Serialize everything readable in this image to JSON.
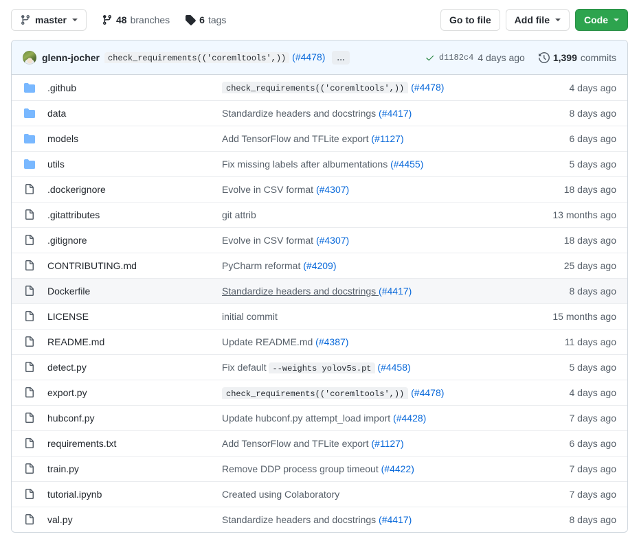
{
  "toolbar": {
    "branch": {
      "name": "master",
      "icon": "git-branch-icon",
      "caret": "chevron-down-icon"
    },
    "branches": {
      "count": "48",
      "label": "branches",
      "icon": "git-branch-icon"
    },
    "tags": {
      "count": "6",
      "label": "tags",
      "icon": "tag-icon"
    },
    "go_to_file": "Go to file",
    "add_file": "Add file",
    "code": "Code"
  },
  "commit_header": {
    "avatar": "user-avatar",
    "author": "glenn-jocher",
    "message_code": "check_requirements(('coremltools',))",
    "message_pr": "(#4478)",
    "ellipsis": "...",
    "status_icon": "check-icon",
    "status_check": "✓",
    "sha": "d1182c4",
    "time": "4 days ago",
    "history_icon": "history-icon",
    "commits_count": "1,399",
    "commits_label": "commits"
  },
  "colors": {
    "accent": "#0969da",
    "green_button": "#2da44e",
    "check_green": "#1a7f37",
    "folder_blue": "#79b8ff",
    "file_gray": "#57606a",
    "header_tint": "#f1f8ff",
    "row_hover": "#f6f7f9",
    "border": "#d0d7de",
    "muted_text": "#57606a"
  },
  "files": [
    {
      "type": "folder",
      "icon": "folder-icon",
      "name": ".github",
      "message": "",
      "code": "check_requirements(('coremltools',))",
      "pr": "(#4478)",
      "time": "4 days ago",
      "hovered": false
    },
    {
      "type": "folder",
      "icon": "folder-icon",
      "name": "data",
      "message": "Standardize headers and docstrings ",
      "code": "",
      "pr": "(#4417)",
      "time": "8 days ago",
      "hovered": false
    },
    {
      "type": "folder",
      "icon": "folder-icon",
      "name": "models",
      "message": "Add TensorFlow and TFLite export ",
      "code": "",
      "pr": "(#1127)",
      "time": "6 days ago",
      "hovered": false
    },
    {
      "type": "folder",
      "icon": "folder-icon",
      "name": "utils",
      "message": "Fix missing labels after albumentations ",
      "code": "",
      "pr": "(#4455)",
      "time": "5 days ago",
      "hovered": false
    },
    {
      "type": "file",
      "icon": "file-icon",
      "name": ".dockerignore",
      "message": "Evolve in CSV format ",
      "code": "",
      "pr": "(#4307)",
      "time": "18 days ago",
      "hovered": false
    },
    {
      "type": "file",
      "icon": "file-icon",
      "name": ".gitattributes",
      "message": "git attrib",
      "code": "",
      "pr": "",
      "time": "13 months ago",
      "hovered": false
    },
    {
      "type": "file",
      "icon": "file-icon",
      "name": ".gitignore",
      "message": "Evolve in CSV format ",
      "code": "",
      "pr": "(#4307)",
      "time": "18 days ago",
      "hovered": false
    },
    {
      "type": "file",
      "icon": "file-icon",
      "name": "CONTRIBUTING.md",
      "message": "PyCharm reformat ",
      "code": "",
      "pr": "(#4209)",
      "time": "25 days ago",
      "hovered": false
    },
    {
      "type": "file",
      "icon": "file-icon",
      "name": "Dockerfile",
      "message": "Standardize headers and docstrings ",
      "code": "",
      "pr": "(#4417)",
      "time": "8 days ago",
      "hovered": true
    },
    {
      "type": "file",
      "icon": "file-icon",
      "name": "LICENSE",
      "message": "initial commit",
      "code": "",
      "pr": "",
      "time": "15 months ago",
      "hovered": false
    },
    {
      "type": "file",
      "icon": "file-icon",
      "name": "README.md",
      "message": "Update README.md ",
      "code": "",
      "pr": "(#4387)",
      "time": "11 days ago",
      "hovered": false
    },
    {
      "type": "file",
      "icon": "file-icon",
      "name": "detect.py",
      "message": "Fix default ",
      "code": "--weights yolov5s.pt",
      "pr": "(#4458)",
      "time": "5 days ago",
      "hovered": false
    },
    {
      "type": "file",
      "icon": "file-icon",
      "name": "export.py",
      "message": "",
      "code": "check_requirements(('coremltools',))",
      "pr": "(#4478)",
      "time": "4 days ago",
      "hovered": false
    },
    {
      "type": "file",
      "icon": "file-icon",
      "name": "hubconf.py",
      "message": "Update hubconf.py attempt_load import ",
      "code": "",
      "pr": "(#4428)",
      "time": "7 days ago",
      "hovered": false
    },
    {
      "type": "file",
      "icon": "file-icon",
      "name": "requirements.txt",
      "message": "Add TensorFlow and TFLite export ",
      "code": "",
      "pr": "(#1127)",
      "time": "6 days ago",
      "hovered": false
    },
    {
      "type": "file",
      "icon": "file-icon",
      "name": "train.py",
      "message": "Remove DDP process group timeout ",
      "code": "",
      "pr": "(#4422)",
      "time": "7 days ago",
      "hovered": false
    },
    {
      "type": "file",
      "icon": "file-icon",
      "name": "tutorial.ipynb",
      "message": "Created using Colaboratory",
      "code": "",
      "pr": "",
      "time": "7 days ago",
      "hovered": false
    },
    {
      "type": "file",
      "icon": "file-icon",
      "name": "val.py",
      "message": "Standardize headers and docstrings ",
      "code": "",
      "pr": "(#4417)",
      "time": "8 days ago",
      "hovered": false
    }
  ]
}
